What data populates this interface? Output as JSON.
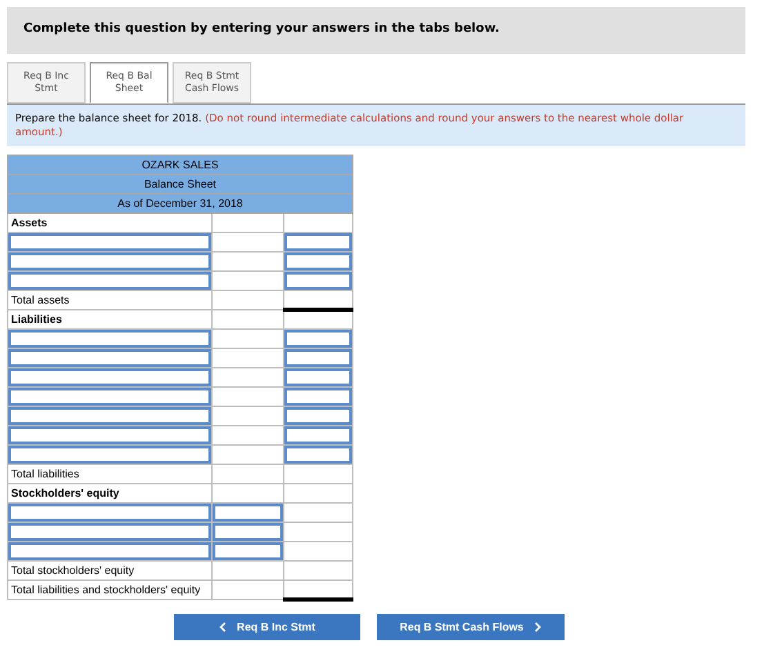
{
  "instruction_banner": "Complete this question by entering your answers in the tabs below.",
  "tabs": [
    {
      "label": "Req B Inc Stmt",
      "selected": false
    },
    {
      "label": "Req B Bal Sheet",
      "selected": true
    },
    {
      "label": "Req B Stmt Cash Flows",
      "selected": false
    }
  ],
  "prompt": {
    "text": "Prepare the balance sheet for 2018.",
    "note": "(Do not round intermediate calculations and round your answers to the nearest whole dollar amount.)"
  },
  "statement": {
    "company": "OZARK SALES",
    "title": "Balance Sheet",
    "date": "As of December 31, 2018",
    "rows": [
      {
        "kind": "heading",
        "label": "Assets"
      },
      {
        "kind": "entry"
      },
      {
        "kind": "entry"
      },
      {
        "kind": "entry"
      },
      {
        "kind": "total",
        "label": "Total assets",
        "double_underline": true
      },
      {
        "kind": "heading",
        "label": "Liabilities"
      },
      {
        "kind": "entry"
      },
      {
        "kind": "entry"
      },
      {
        "kind": "entry"
      },
      {
        "kind": "entry"
      },
      {
        "kind": "entry"
      },
      {
        "kind": "entry"
      },
      {
        "kind": "entry"
      },
      {
        "kind": "total",
        "label": "Total liabilities",
        "double_underline": false
      },
      {
        "kind": "heading",
        "label": "Stockholders' equity"
      },
      {
        "kind": "detail"
      },
      {
        "kind": "detail"
      },
      {
        "kind": "detail"
      },
      {
        "kind": "total",
        "label": "Total stockholders' equity",
        "double_underline": false
      },
      {
        "kind": "total",
        "label": "Total liabilities and stockholders' equity",
        "double_underline": true
      }
    ]
  },
  "nav": {
    "previous": "Req B Inc Stmt",
    "next": "Req B Stmt Cash Flows"
  }
}
